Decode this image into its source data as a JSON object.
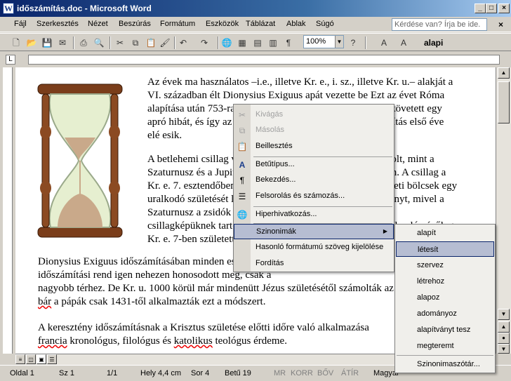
{
  "window": {
    "title": "időszámítás.doc - Microsoft Word"
  },
  "menubar": {
    "items": [
      "Fájl",
      "Szerkesztés",
      "Nézet",
      "Beszúrás",
      "Formátum",
      "Eszközök",
      "Táblázat",
      "Ablak",
      "Súgó"
    ],
    "help_placeholder": "Kérdése van? Írja be ide."
  },
  "toolbar": {
    "zoom": "100%",
    "style": "alapi"
  },
  "document": {
    "para1": "Az évek ma használatos –i.e., illetve Kr. e., i. sz., illetve Kr. u.– alakját a VI. században élt Dionysius Exiguus apát vezette be Ezt az évet Róma alapítása után 753-ra tette. A számítások során azonban elkövetett egy apró hibát, és így az időszámítás kezdete jóval az időszámítás első éve elé esik.",
    "para2": "A betlehemi csillag valószínűleg egy bolygó-együttállás volt, mint a Szaturnusz és a Jupiter együttállása a Halak csillagképében. A csillag a Kr. e. 7. esztendőben volt látható, az ott élő babiloni és keleti bölcsek egy uralkodó születését látták benne. Így értelmezték az eseményt, mivel a Szaturnusz a zsidók védőcsillaga, a Jupiter királycsillag a csillagképüknek tartották. Jézus tehát nagy valószínűséggel valószínűleg Kr. e. 7-ben született.",
    "para3_a": "Dionysius Exiguus időszámításában minden eseményt Krisztus születésétől számított. A keresztény időszámítási rend igen nehezen honosodott meg, csak a ",
    "para3_b": "nagyobb térhez. De Kr. u. 1000 körül már mindenütt Jézus születésétől számolták az éveket, ",
    "para3_c1": "bár",
    "para3_c2": " a pápák csak 1431-től alkalmazták ezt a módszert.",
    "para4_a": "A keresztény időszámításnak a Krisztus születése előtti időre való alkalmazása ",
    "para4_b1": "francia",
    "para4_b2": " kronológus, filológus és ",
    "para4_b3": "katolikus",
    "para4_b4": " teológus érdeme."
  },
  "context_menu": {
    "items": [
      "Kivágás",
      "Másolás",
      "Beillesztés",
      "Betűtípus...",
      "Bekezdés...",
      "Felsorolás és számozás...",
      "Hiperhivatkozás...",
      "Szinonimák",
      "Hasonló formátumú szöveg kijelölése",
      "Fordítás"
    ]
  },
  "synonyms": {
    "items": [
      "alapít",
      "létesít",
      "szervez",
      "létrehoz",
      "alapoz",
      "adományoz",
      "alapítványt tesz",
      "megteremt"
    ],
    "footer": "Szinonimaszótár..."
  },
  "statusbar": {
    "page": "Oldal 1",
    "section": "Sz 1",
    "pages": "1/1",
    "position": "Hely 4,4 cm",
    "line": "Sor 4",
    "column": "Betű 19",
    "rec": "MR",
    "trk": "KORR",
    "ext": "BŐV",
    "ovr": "ÁTÍR",
    "language": "Magyar"
  }
}
